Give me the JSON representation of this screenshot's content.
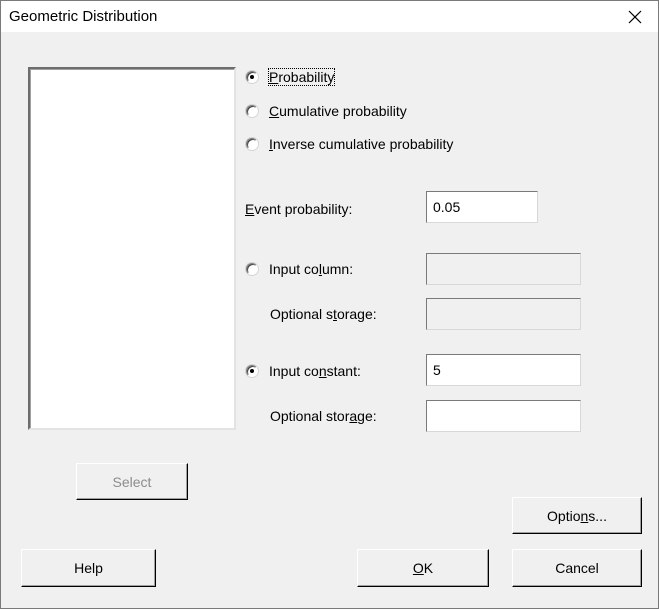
{
  "window": {
    "title": "Geometric Distribution",
    "close_glyph": "✕"
  },
  "options": [
    {
      "id": "probability",
      "pre": "",
      "u": "P",
      "post": "robability",
      "checked": true
    },
    {
      "id": "cumulative",
      "pre": "",
      "u": "C",
      "post": "umulative probability",
      "checked": false
    },
    {
      "id": "inverse",
      "pre": "",
      "u": "I",
      "post": "nverse cumulative probability",
      "checked": false
    }
  ],
  "event_probability": {
    "label_pre": "",
    "label_u": "E",
    "label_post": "vent probability:",
    "value": "0.05"
  },
  "input_column": {
    "label_pre": "Input co",
    "label_u": "l",
    "label_post": "umn:",
    "checked": false,
    "value": "",
    "storage_label_pre": "Optional s",
    "storage_label_u": "t",
    "storage_label_post": "orage:",
    "storage_value": ""
  },
  "input_constant": {
    "label_pre": "Input co",
    "label_u": "n",
    "label_post": "stant:",
    "checked": true,
    "value": "5",
    "storage_label_pre": "Optional stor",
    "storage_label_u": "a",
    "storage_label_post": "ge:",
    "storage_value": ""
  },
  "buttons": {
    "select": "Select",
    "options_pre": "Optio",
    "options_u": "n",
    "options_post": "s...",
    "help": "Help",
    "ok_pre": "",
    "ok_u": "O",
    "ok_post": "K",
    "cancel": "Cancel"
  }
}
